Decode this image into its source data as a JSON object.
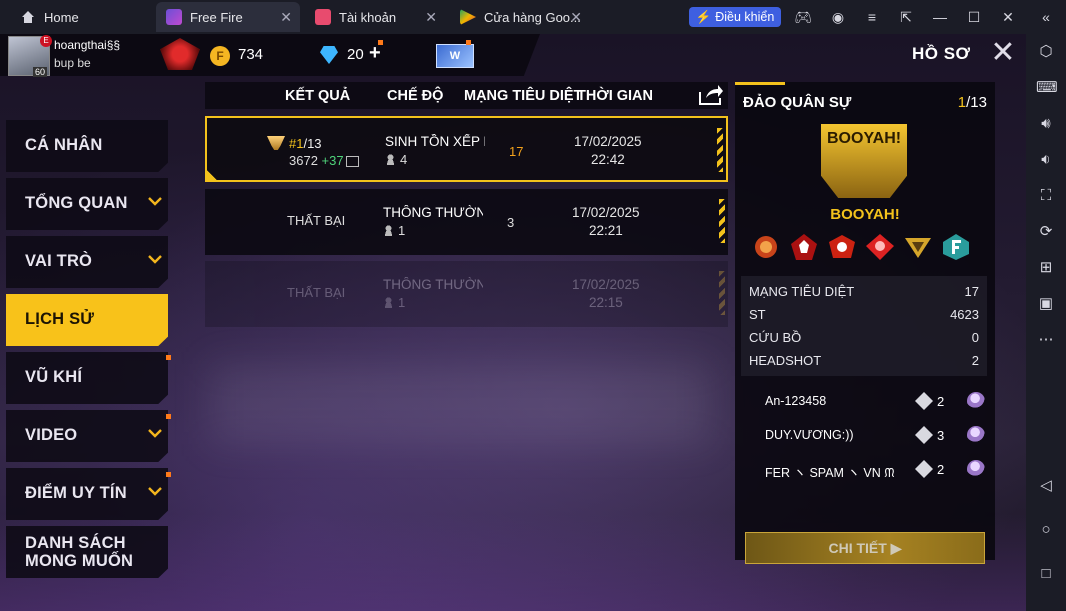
{
  "tabs": [
    {
      "label": "Home"
    },
    {
      "label": "Free Fire"
    },
    {
      "label": "Tài khoản"
    },
    {
      "label": "Cửa hàng Goo..."
    }
  ],
  "toolbar": {
    "control_label": "Điều khiển"
  },
  "profile": {
    "username": "hoangthai§§",
    "subname": "bup be",
    "level": "60",
    "rank_badge_letter": "E",
    "coins": "734",
    "diamonds": "20",
    "diamonds_plus": "+",
    "card_label": "W",
    "coin_letter": "F"
  },
  "header": {
    "title": "HỒ SƠ"
  },
  "nav": {
    "items": [
      {
        "label": "CÁ NHÂN"
      },
      {
        "label": "TỔNG QUAN"
      },
      {
        "label": "VAI TRÒ"
      },
      {
        "label": "LỊCH SỬ"
      },
      {
        "label": "VŨ KHÍ"
      },
      {
        "label": "VIDEO"
      },
      {
        "label": "ĐIỂM UY TÍN"
      },
      {
        "label": "DANH SÁCH\nMONG MUỐN"
      }
    ]
  },
  "table": {
    "headers": [
      "KẾT QUẢ",
      "CHẾ ĐỘ",
      "MẠNG TIÊU DIỆT",
      "THỜI GIAN"
    ],
    "rows": [
      {
        "rank": "#1",
        "rank_total": "/13",
        "points": "3672",
        "points_delta": "+37",
        "mode": "SINH TỒN XẾP HẠNG",
        "players": "4",
        "kills": "17",
        "date": "17/02/2025",
        "time": "22:42"
      },
      {
        "result": "THẤT BẠI",
        "mode": "THÔNG THƯỜNG-I",
        "players": "1",
        "kills": "3",
        "date": "17/02/2025",
        "time": "22:21"
      },
      {
        "result": "THẤT BẠI",
        "mode": "THÔNG THƯỜNG-I",
        "players": "1",
        "kills": "",
        "date": "17/02/2025",
        "time": "22:15"
      }
    ]
  },
  "detail": {
    "map": "ĐẢO QUÂN SỰ",
    "rank": "1",
    "rank_total": "/13",
    "booyah_banner": "BOOYAH!",
    "booyah_label": "BOOYAH!",
    "stats": [
      {
        "label": "MẠNG TIÊU DIỆT",
        "value": "17"
      },
      {
        "label": "ST",
        "value": "4623"
      },
      {
        "label": "CỨU BỒ",
        "value": "0"
      },
      {
        "label": "HEADSHOT",
        "value": "2"
      }
    ],
    "players": [
      {
        "name": "An-123458",
        "kills": "2"
      },
      {
        "name": "DUY.VƯƠNG:))",
        "kills": "3"
      },
      {
        "name": "FER ヽ SPAM ヽ VN ᙏ",
        "kills": "2"
      }
    ],
    "button": "CHI TIẾT"
  },
  "colors": {
    "accent": "#f3c21c",
    "control_button": "#3e5fe0"
  }
}
